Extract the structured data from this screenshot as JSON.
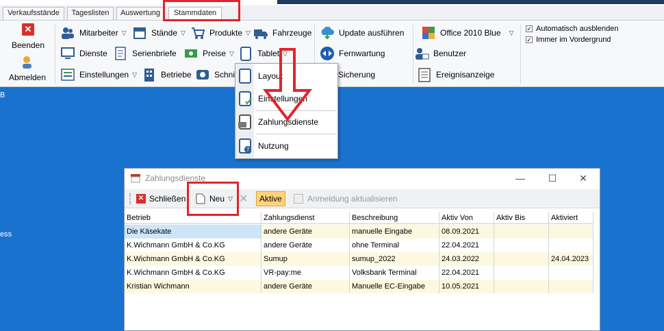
{
  "tabs": [
    {
      "label": "Verkaufsstände"
    },
    {
      "label": "Tageslisten"
    },
    {
      "label": "Auswertung"
    },
    {
      "label": "Stammdaten"
    }
  ],
  "ribbon": {
    "beenden": "Beenden",
    "abmelden": "Abmelden",
    "mitarbeiter": "Mitarbeiter",
    "staende": "Stände",
    "produkte": "Produkte",
    "fahrzeuge": "Fahrzeuge",
    "dienste": "Dienste",
    "serienbriefe": "Serienbriefe",
    "preise": "Preise",
    "tablet": "Tablet",
    "einstellungen": "Einstellungen",
    "betriebe": "Betriebe",
    "schnittstellen": "Schnit",
    "update": "Update ausführen",
    "fernwartung": "Fernwartung",
    "sicherung": "Sicherung",
    "theme": "Office 2010 Blue",
    "benutzer": "Benutzer",
    "ereignisanzeige": "Ereignisanzeige",
    "auto_hide": "Automatisch ausblenden",
    "always_front": "Immer im Vordergrund"
  },
  "desktop": {
    "left_char": "B",
    "left_text": "ess"
  },
  "tablet_menu": {
    "items": [
      {
        "label": "Layout"
      },
      {
        "label": "Einstellungen"
      },
      {
        "label": "Zahlungsdienste"
      },
      {
        "label": "Nutzung"
      }
    ]
  },
  "dialog": {
    "title": "Zahlungsdienste",
    "toolbar": {
      "close": "Schließen",
      "new": "Neu",
      "active": "Aktive",
      "refresh": "Anmeldung aktualisieren"
    },
    "columns": [
      "Betrieb",
      "Zahlungsdienst",
      "Beschreibung",
      "Aktiv Von",
      "Aktiv Bis",
      "Aktiviert"
    ],
    "rows": [
      [
        "Die Käsekate",
        "andere Geräte",
        "manuelle Eingabe",
        "08.09.2021",
        "",
        ""
      ],
      [
        "K.Wichmann GmbH & Co.KG",
        "andere Geräte",
        "ohne Terminal",
        "22.04.2021",
        "",
        ""
      ],
      [
        "K.Wichmann GmbH & Co.KG",
        "Sumup",
        "sumup_2022",
        "24.03.2022",
        "",
        "24.04.2023"
      ],
      [
        "K.Wichmann GmbH & Co.KG",
        "VR-pay:me",
        "Volksbank Terminal",
        "22.04.2021",
        "",
        ""
      ],
      [
        "Kristian Wichmann",
        "andere Geräte",
        "Manuelle EC-Eingabe",
        "10.05.2021",
        "",
        ""
      ]
    ]
  },
  "colors": {
    "desktop": "#1a72cf",
    "highlight_red": "#e1242b",
    "row_alt": "#fdf9e1",
    "selected": "#cde6f7"
  }
}
